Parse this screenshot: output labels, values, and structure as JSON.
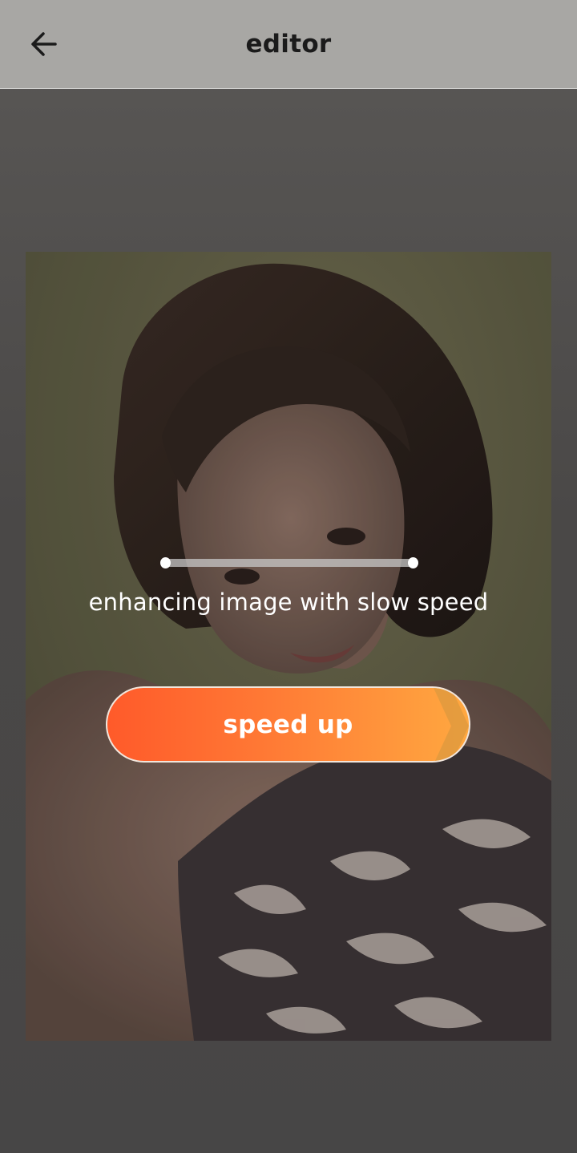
{
  "header": {
    "title": "editor",
    "back_icon": "arrow-left-icon"
  },
  "processing": {
    "status_text": "enhancing image with slow speed",
    "progress": 1.0
  },
  "speed_button": {
    "label": "speed up",
    "gradient_start": "#ff5a2a",
    "gradient_end": "#ffa840"
  },
  "colors": {
    "topbar": "#a8a7a4",
    "background": "#4a4847",
    "text": "#ffffff"
  }
}
